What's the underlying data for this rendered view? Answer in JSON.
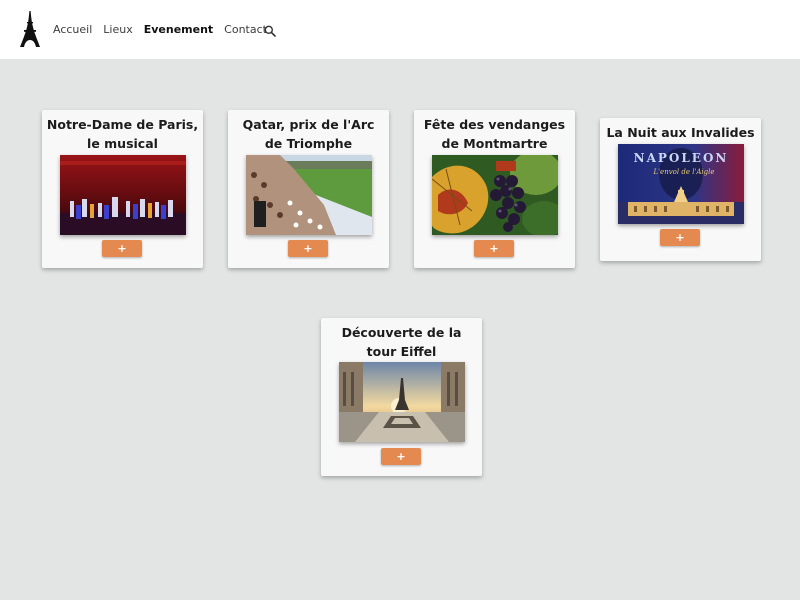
{
  "nav": {
    "items": [
      {
        "label": "Accueil",
        "active": false
      },
      {
        "label": "Lieux",
        "active": false
      },
      {
        "label": "Evenement",
        "active": true
      },
      {
        "label": "Contact",
        "active": false
      }
    ],
    "search_icon": "search-icon",
    "logo_icon": "eiffel-tower-icon"
  },
  "events": [
    {
      "title": "Notre-Dame de Paris, le musical",
      "button_label": "+",
      "image": "stage-performance-image"
    },
    {
      "title": "Qatar, prix de l'Arc de Triomphe",
      "button_label": "+",
      "image": "horse-race-crowd-image"
    },
    {
      "title": "Fête des vendanges de Montmartre",
      "button_label": "+",
      "image": "grapes-vine-image"
    },
    {
      "title": "La Nuit aux Invalides",
      "button_label": "+",
      "image": "napoleon-poster-image",
      "image_text": {
        "headline": "NAPOLEON",
        "tagline": "L'envol de l'Aigle"
      }
    },
    {
      "title": "Découverte de la tour Eiffel",
      "button_label": "+",
      "image": "eiffel-trocadero-image"
    }
  ],
  "colors": {
    "background": "#e2e5e4",
    "header": "#ffffff",
    "card": "#f8f8f8",
    "button": "#e48a51"
  }
}
